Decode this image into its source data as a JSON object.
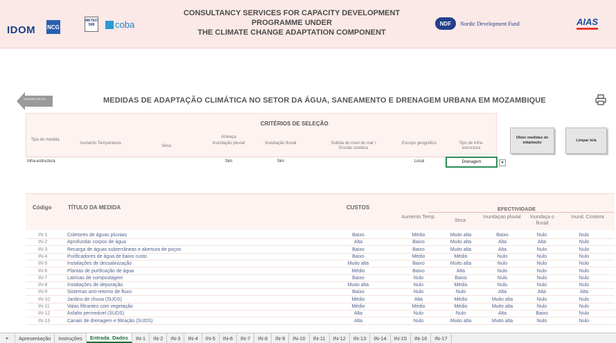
{
  "header": {
    "title_line1": "CONSULTANCY SERVICES FOR CAPACITY DEVELOPMENT PROGRAMME UNDER",
    "title_line2": "THE CLIMATE CHANGE ADAPTATION COMPONENT",
    "logos": {
      "idom": "IDOM",
      "ncg": "NCG",
      "meteo": "METEO SIM",
      "coba": "coba",
      "ndf_mark": "NDF",
      "ndf_text": "Nordic Development Fund",
      "aias": "AIAS"
    }
  },
  "back_button": {
    "label": "Instruções de uso"
  },
  "page_title": "MEDIDAS DE ADAPTAÇÃO CLIMÁTICA NO SETOR DA ÁGUA, SANEAMENTO E DRENAGEM URBANA EM MOZAMBIQUE",
  "print_icon": "printer-icon",
  "criteria": {
    "title": "CRITÉRIOS DE SELEÇÃO",
    "headers": {
      "tipo_medida": "Tipo de medida",
      "aumento_temp": "Aumento Temperatura",
      "ameaca": "Ameaça",
      "seca": "Seca",
      "inund_pluvial": "Inundação pluvial",
      "inund_fluvial": "Inundação fluvial",
      "subida_mar": "Subida do nível do mar / Erosão costeira",
      "escopo": "Escopo geográfico",
      "tipo_infra": "Tipo de infra-estructura"
    },
    "values": {
      "tipo_medida": "Infra-estructura",
      "inund_pluvial": "Sim",
      "inund_fluvial": "Sim",
      "escopo": "Local",
      "tipo_infra": "Drenagem"
    },
    "obter_button": "Obter medidas de adaptação",
    "limpar_button": "Limpar tela"
  },
  "table": {
    "headers": {
      "codigo": "Código",
      "titulo": "TÍTULO DA MEDIDA",
      "custos": "CUSTOS",
      "efectividade": "EFECTIVIDADE",
      "aumento_temp": "Aumento Temp.",
      "seca": "Seca",
      "inund_pluvial": "Inundaçao pluvial",
      "inund_fluvial": "Inundaça o fluvial",
      "inund_costeira": "Inund. Costeira"
    },
    "rows": [
      {
        "code": "IN-1",
        "title": "Coletores de águas pluviais",
        "cost": "Baixo",
        "temp": "Médio",
        "seca": "Muito alta",
        "pluv": "Baixo",
        "fluv": "Nulo",
        "cost2": "Nulo"
      },
      {
        "code": "IN-2",
        "title": "Aprofundar corpos de água",
        "cost": "Alta",
        "temp": "Baixo",
        "seca": "Muito alta",
        "pluv": "Alta",
        "fluv": "Alta",
        "cost2": "Nulo"
      },
      {
        "code": "IN-3",
        "title": "Recarga de águas subterrâneas e abertura de poços",
        "cost": "Baixo",
        "temp": "Baixo",
        "seca": "Muito alta",
        "pluv": "Alta",
        "fluv": "Nulo",
        "cost2": "Nulo"
      },
      {
        "code": "IN-4",
        "title": "Purificadores de água de baixo custo",
        "cost": "Baixo",
        "temp": "Médio",
        "seca": "Médio",
        "pluv": "Nulo",
        "fluv": "Nulo",
        "cost2": "Nulo"
      },
      {
        "code": "IN-5",
        "title": "Instalações de dessalinização",
        "cost": "Muito alta",
        "temp": "Baixo",
        "seca": "Muito alta",
        "pluv": "Nulo",
        "fluv": "Nulo",
        "cost2": "Nulo"
      },
      {
        "code": "IN-6",
        "title": "Plantas de purificação de água",
        "cost": "Médio",
        "temp": "Baixo",
        "seca": "Alta",
        "pluv": "Nulo",
        "fluv": "Nulo",
        "cost2": "Nulo"
      },
      {
        "code": "IN-7",
        "title": "Latrinas de compostagem",
        "cost": "Baixo",
        "temp": "Nulo",
        "seca": "Baixo",
        "pluv": "Nulo",
        "fluv": "Nulo",
        "cost2": "Nulo"
      },
      {
        "code": "IN-8",
        "title": "Instalações de depuração",
        "cost": "Muito alta",
        "temp": "Nulo",
        "seca": "Médio",
        "pluv": "Nulo",
        "fluv": "Nulo",
        "cost2": "Nulo"
      },
      {
        "code": "IN-9",
        "title": "Sistemas anti-retorno de fluxo",
        "cost": "Baixo",
        "temp": "Nulo",
        "seca": "Nulo",
        "pluv": "Alta",
        "fluv": "Alta",
        "cost2": "Alta"
      },
      {
        "code": "IN-10",
        "title": "Jardins de chuva (SUDS)",
        "cost": "Médio",
        "temp": "Alta",
        "seca": "Médio",
        "pluv": "Muito alta",
        "fluv": "Nulo",
        "cost2": "Nulo"
      },
      {
        "code": "IN-11",
        "title": "Valas filtrantes com vegetação",
        "cost": "Médio",
        "temp": "Médio",
        "seca": "Médio",
        "pluv": "Muito alta",
        "fluv": "Nulo",
        "cost2": "Nulo"
      },
      {
        "code": "IN-12",
        "title": "Asfalto permeável (SUDS)",
        "cost": "Alta",
        "temp": "Nulo",
        "seca": "Nulo",
        "pluv": "Alta",
        "fluv": "Baixo",
        "cost2": "Nulo"
      },
      {
        "code": "IN-13",
        "title": "Canais de drenagem e filtração (SUDS)",
        "cost": "Alta",
        "temp": "Nulo",
        "seca": "Muito alta",
        "pluv": "Muito alta",
        "fluv": "Nulo",
        "cost2": "Nulo"
      }
    ]
  },
  "tabs": {
    "nav": "▸",
    "items": [
      "Apresentação",
      "Instruções",
      "Entrada_Dados",
      "IN-1",
      "IN-2",
      "IN-3",
      "IN-4",
      "IN-5",
      "IN-6",
      "IN-7",
      "IN-8",
      "IN-9",
      "IN-10",
      "IN-11",
      "IN-12",
      "IN-13",
      "IN-14",
      "IN-15",
      "IN-16",
      "IN-17"
    ],
    "active": "Entrada_Dados"
  }
}
